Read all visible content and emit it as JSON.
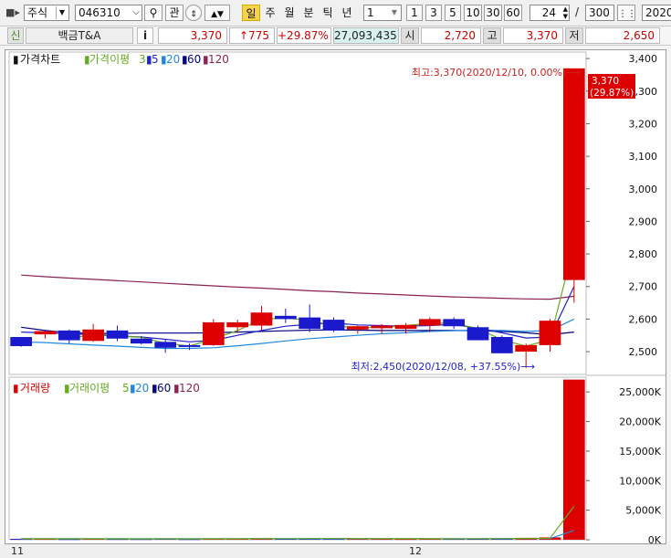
{
  "toolbar": {
    "market_type": "주식",
    "code": "046310",
    "watch_label": "관",
    "periods": [
      "일",
      "주",
      "월",
      "분",
      "틱",
      "년"
    ],
    "interval_value": "1",
    "quick_intervals": [
      "1",
      "3",
      "5",
      "10",
      "30",
      "60"
    ],
    "count_value": "24",
    "count_total": "300",
    "count_sep": "/",
    "date_value": "2020/"
  },
  "info": {
    "credit_badge": "신",
    "stock_name": "백금T&A",
    "info_button": "i",
    "price": "3,370",
    "change": "↑775",
    "change_pct": "+29.87%",
    "volume": "27,093,435",
    "open_label": "시",
    "open": "2,720",
    "high_label": "고",
    "high": "3,370",
    "low_label": "저",
    "low": "2,650"
  },
  "colors": {
    "up": "#dd0000",
    "down": "#1a1acc",
    "ma3": "#66aa22",
    "ma5": "#2222cc",
    "ma20": "#2288dd",
    "ma60": "#000080",
    "ma120": "#8b2252"
  },
  "chart_data": [
    {
      "type": "candlestick",
      "legend_title": "가격차트",
      "legend_ma_label": "가격이평",
      "ma_periods": [
        "3",
        "5",
        "20",
        "60",
        "120"
      ],
      "ylim": [
        2430,
        3420
      ],
      "yticks": [
        2500,
        2600,
        2700,
        2800,
        2900,
        3000,
        3100,
        3200,
        3300,
        3400
      ],
      "ytick_labels": [
        "2,500",
        "2,600",
        "2,700",
        "2,800",
        "2,900",
        "3,000",
        "3,100",
        "3,200",
        "3,300",
        "3,400"
      ],
      "candles": [
        {
          "o": 2545,
          "h": 2545,
          "l": 2515,
          "c": 2517
        },
        {
          "o": 2553,
          "h": 2560,
          "l": 2540,
          "c": 2563
        },
        {
          "o": 2565,
          "h": 2568,
          "l": 2525,
          "c": 2535
        },
        {
          "o": 2533,
          "h": 2585,
          "l": 2530,
          "c": 2568
        },
        {
          "o": 2565,
          "h": 2580,
          "l": 2532,
          "c": 2540
        },
        {
          "o": 2540,
          "h": 2548,
          "l": 2522,
          "c": 2525
        },
        {
          "o": 2530,
          "h": 2538,
          "l": 2496,
          "c": 2512
        },
        {
          "o": 2520,
          "h": 2525,
          "l": 2505,
          "c": 2515
        },
        {
          "o": 2520,
          "h": 2600,
          "l": 2518,
          "c": 2590
        },
        {
          "o": 2575,
          "h": 2598,
          "l": 2560,
          "c": 2590
        },
        {
          "o": 2580,
          "h": 2640,
          "l": 2565,
          "c": 2620
        },
        {
          "o": 2610,
          "h": 2632,
          "l": 2588,
          "c": 2600
        },
        {
          "o": 2605,
          "h": 2645,
          "l": 2560,
          "c": 2570
        },
        {
          "o": 2598,
          "h": 2605,
          "l": 2560,
          "c": 2565
        },
        {
          "o": 2568,
          "h": 2580,
          "l": 2555,
          "c": 2578
        },
        {
          "o": 2572,
          "h": 2585,
          "l": 2555,
          "c": 2580
        },
        {
          "o": 2570,
          "h": 2588,
          "l": 2555,
          "c": 2582
        },
        {
          "o": 2580,
          "h": 2605,
          "l": 2560,
          "c": 2600
        },
        {
          "o": 2600,
          "h": 2605,
          "l": 2570,
          "c": 2578
        },
        {
          "o": 2575,
          "h": 2580,
          "l": 2535,
          "c": 2535
        },
        {
          "o": 2545,
          "h": 2550,
          "l": 2495,
          "c": 2495
        },
        {
          "o": 2500,
          "h": 2525,
          "l": 2450,
          "c": 2520
        },
        {
          "o": 2520,
          "h": 2600,
          "l": 2500,
          "c": 2595
        },
        {
          "o": 2720,
          "h": 3370,
          "l": 2650,
          "c": 3370
        }
      ],
      "ma": {
        "ma3": [
          null,
          null,
          2538,
          2555,
          2548,
          2544,
          2526,
          2517,
          2539,
          2565,
          2600,
          2603,
          2597,
          2578,
          2574,
          2574,
          2580,
          2587,
          2587,
          2571,
          2536,
          2517,
          2537,
          2828
        ],
        "ma5": [
          2560,
          2558,
          2555,
          2552,
          2548,
          2545,
          2538,
          2530,
          2535,
          2550,
          2565,
          2578,
          2584,
          2588,
          2582,
          2580,
          2578,
          2580,
          2584,
          2571,
          2558,
          2542,
          2545,
          2700
        ],
        "ma20": [
          2530,
          2528,
          2524,
          2520,
          2517,
          2513,
          2510,
          2510,
          2512,
          2518,
          2525,
          2533,
          2540,
          2545,
          2550,
          2555,
          2558,
          2562,
          2564,
          2566,
          2565,
          2562,
          2565,
          2600
        ],
        "ma60": [
          2575,
          2565,
          2558,
          2556,
          2556,
          2557,
          2557,
          2557,
          2558,
          2560,
          2562,
          2564,
          2566,
          2567,
          2566,
          2565,
          2565,
          2565,
          2565,
          2564,
          2562,
          2558,
          2552,
          2560
        ],
        "ma120": [
          2735,
          2730,
          2726,
          2722,
          2718,
          2714,
          2710,
          2706,
          2702,
          2698,
          2695,
          2691,
          2687,
          2684,
          2680,
          2677,
          2674,
          2671,
          2668,
          2666,
          2664,
          2662,
          2661,
          2670
        ]
      },
      "current_price_tag": "3,370",
      "current_pct_tag": "(29.87%)",
      "annotation_high": "최고:3,370(2020/12/10, 0.00%)⟶",
      "annotation_low": "최저:2,450(2020/12/08, +37.55%)⟶"
    },
    {
      "type": "bar",
      "legend_title": "거래량",
      "legend_ma_label": "거래이평",
      "ma_periods": [
        "5",
        "20",
        "60",
        "120"
      ],
      "ylim": [
        0,
        27500
      ],
      "unit": "K",
      "yticks": [
        0,
        5000,
        10000,
        15000,
        20000,
        25000
      ],
      "ytick_labels": [
        "0K",
        "5,000K",
        "10,000K",
        "15,000K",
        "20,000K",
        "25,000K"
      ],
      "values": [
        150,
        180,
        120,
        160,
        140,
        130,
        170,
        120,
        200,
        170,
        260,
        190,
        220,
        180,
        160,
        150,
        140,
        180,
        170,
        210,
        250,
        320,
        400,
        27093
      ],
      "ma": {
        "ma5": [
          160,
          160,
          150,
          152,
          152,
          144,
          152,
          146,
          152,
          158,
          184,
          192,
          208,
          204,
          202,
          180,
          170,
          166,
          160,
          170,
          190,
          226,
          270,
          5655
        ],
        "ma20": [
          170,
          170,
          168,
          168,
          166,
          165,
          165,
          164,
          165,
          166,
          170,
          172,
          175,
          176,
          177,
          178,
          178,
          180,
          182,
          186,
          190,
          196,
          205,
          1560
        ]
      },
      "xtick_labels": [
        {
          "index": 0,
          "label": "11"
        },
        {
          "index": 16,
          "label": "12"
        }
      ]
    }
  ]
}
